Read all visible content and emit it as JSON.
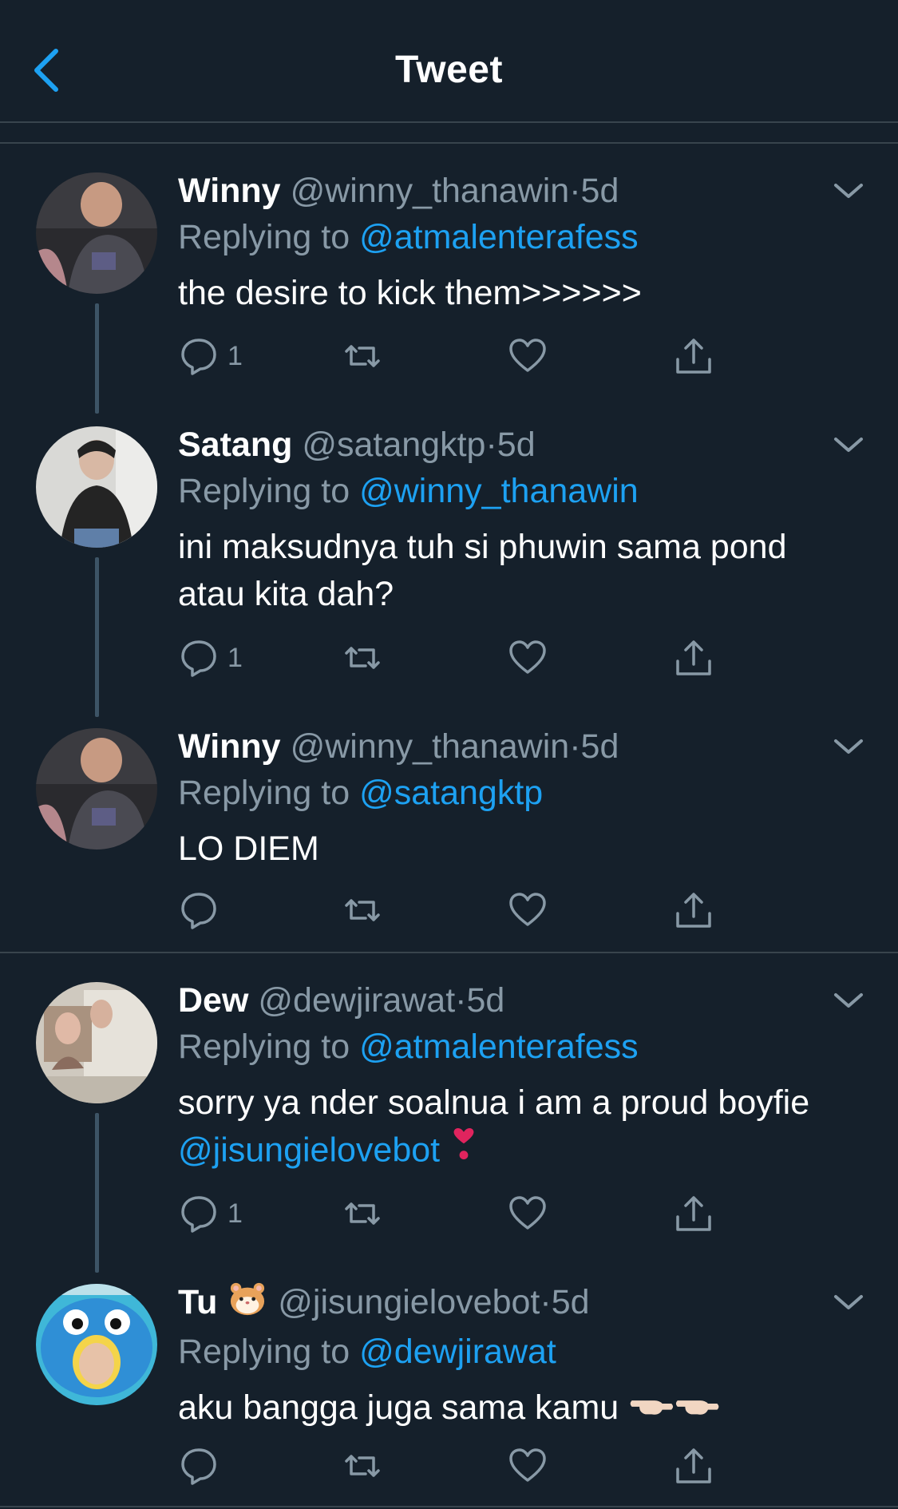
{
  "header": {
    "title": "Tweet"
  },
  "tweets": [
    {
      "name": "Winny",
      "handle": "@winny_thanawin",
      "time": "5d",
      "reply_prefix": "Replying to ",
      "reply_to": "@atmalenterafess",
      "text": "the desire to kick them>>>>>>",
      "reply_count": "1"
    },
    {
      "name": "Satang",
      "handle": "@satangktp",
      "time": "5d",
      "reply_prefix": "Replying to ",
      "reply_to": "@winny_thanawin",
      "text_line1": "ini maksudnya tuh si phuwin sama pond",
      "text_line2": "atau kita dah?",
      "reply_count": "1"
    },
    {
      "name": "Winny",
      "handle": "@winny_thanawin",
      "time": "5d",
      "reply_prefix": "Replying to ",
      "reply_to": "@satangktp",
      "text": "LO DIEM",
      "reply_count": ""
    },
    {
      "name": "Dew",
      "handle": "@dewjirawat",
      "time": "5d",
      "reply_prefix": "Replying to ",
      "reply_to": "@atmalenterafess",
      "text_line1": "sorry ya nder soalnua i am a proud boyfie",
      "text_mention": "@jisungielovebot",
      "text_emoji": "❣️",
      "reply_count": "1"
    },
    {
      "name": "Tu",
      "name_emoji": "🐹",
      "handle": "@jisungielovebot",
      "time": "5d",
      "reply_prefix": "Replying to ",
      "reply_to": "@dewjirawat",
      "text": "aku bangga juga sama kamu",
      "text_emoji": "👈🏻👈🏻",
      "reply_count": ""
    }
  ],
  "separator": "·",
  "colors": {
    "background": "#15202b",
    "accent": "#1da1f2",
    "muted": "#8899a6",
    "border": "#38444d"
  }
}
